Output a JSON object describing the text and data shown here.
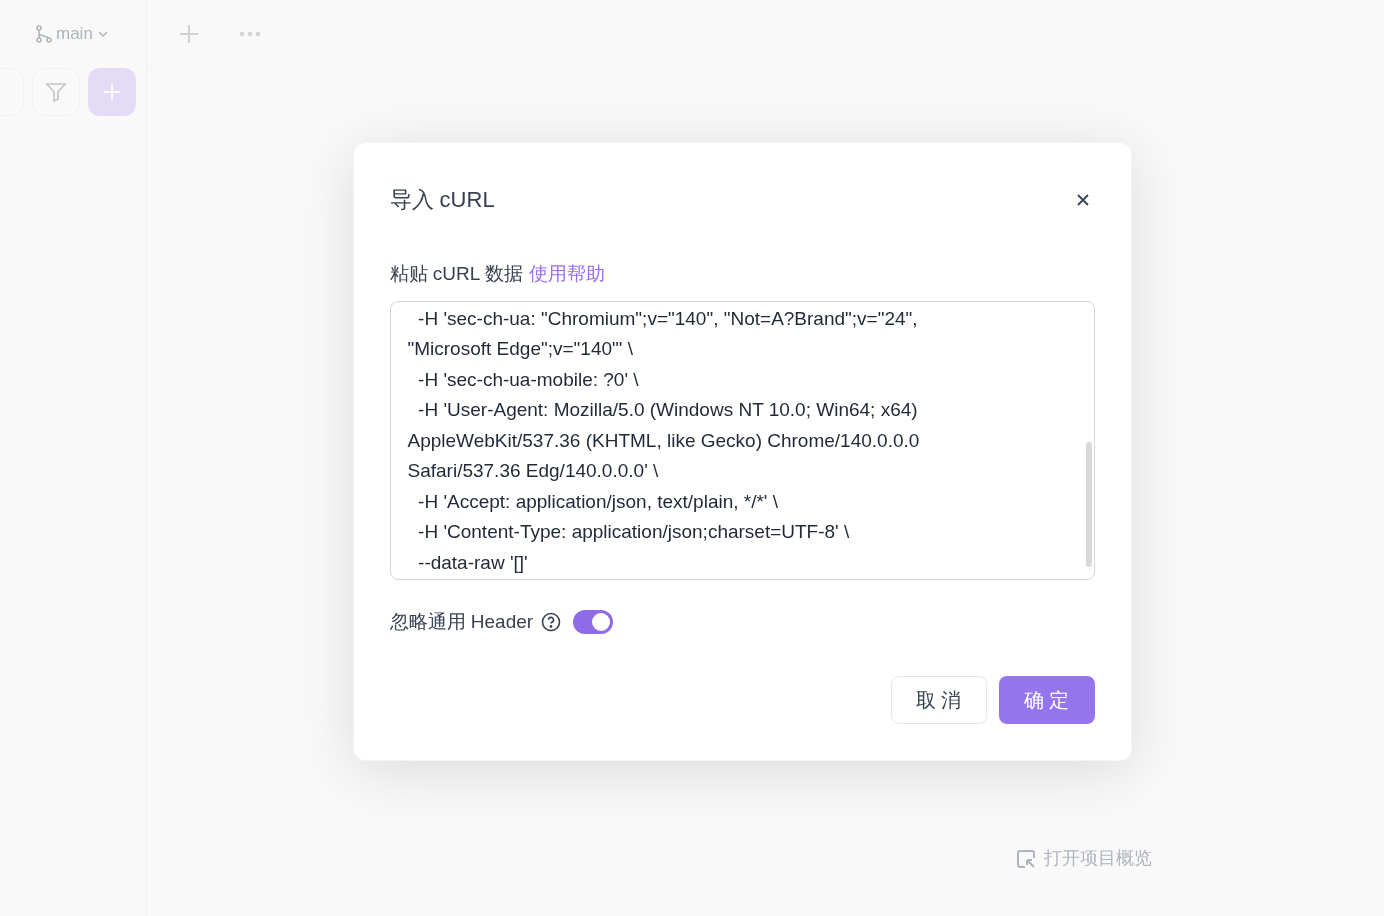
{
  "background": {
    "branch": "main",
    "open_overview": "打开项目概览"
  },
  "dialog": {
    "title": "导入 cURL",
    "label": "粘贴 cURL 数据",
    "help_link": "使用帮助",
    "curl_lines": [
      "  -H 'sec-ch-ua: \"Chromium\";v=\"140\", \"Not=A?Brand\";v=\"24\",",
      "\"Microsoft Edge\";v=\"140\"' \\",
      "  -H 'sec-ch-ua-mobile: ?0' \\",
      "  -H 'User-Agent: Mozilla/5.0 (Windows NT 10.0; Win64; x64)",
      "AppleWebKit/537.36 (KHTML, like Gecko) Chrome/140.0.0.0",
      "Safari/537.36 Edg/140.0.0.0' \\",
      "  -H 'Accept: application/json, text/plain, */*' \\",
      "  -H 'Content-Type: application/json;charset=UTF-8' \\",
      "  --data-raw '[]'"
    ],
    "ignore_header": {
      "label": "忽略通用 Header",
      "on": true
    },
    "buttons": [
      {
        "label": "取 消",
        "kind": "secondary"
      },
      {
        "label": "确 定",
        "kind": "primary"
      }
    ]
  }
}
